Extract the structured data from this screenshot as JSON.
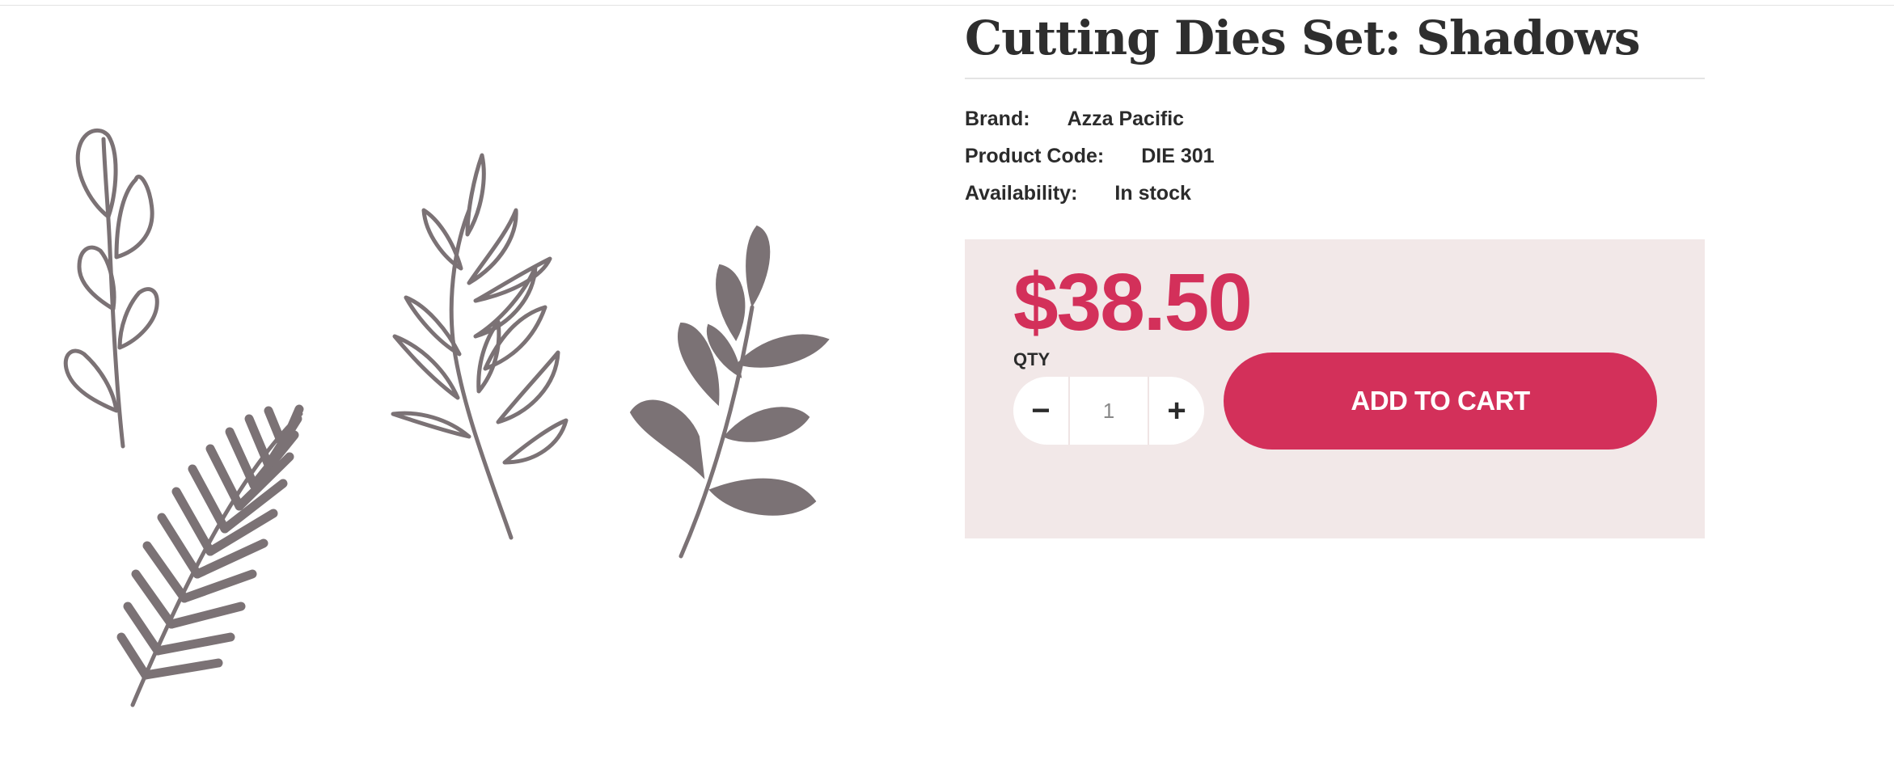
{
  "product": {
    "title": "Cutting Dies Set: Shadows",
    "brand_label": "Brand:",
    "brand": "Azza Pacific",
    "code_label": "Product Code:",
    "code": "DIE 301",
    "availability_label": "Availability:",
    "availability": "In stock"
  },
  "purchase": {
    "price": "$38.50",
    "qty_label": "QTY",
    "qty_value": "1",
    "minus_symbol": "−",
    "plus_symbol": "+",
    "add_to_cart_label": "ADD TO CART"
  },
  "colors": {
    "accent": "#d3305a",
    "buy_box_bg": "#f2e8e8",
    "leaf": "#7b7275"
  },
  "image": {
    "icons": [
      "eucalyptus-outline-icon",
      "fern-frond-icon",
      "willow-branch-outline-icon",
      "filled-leaf-sprig-icon"
    ]
  }
}
